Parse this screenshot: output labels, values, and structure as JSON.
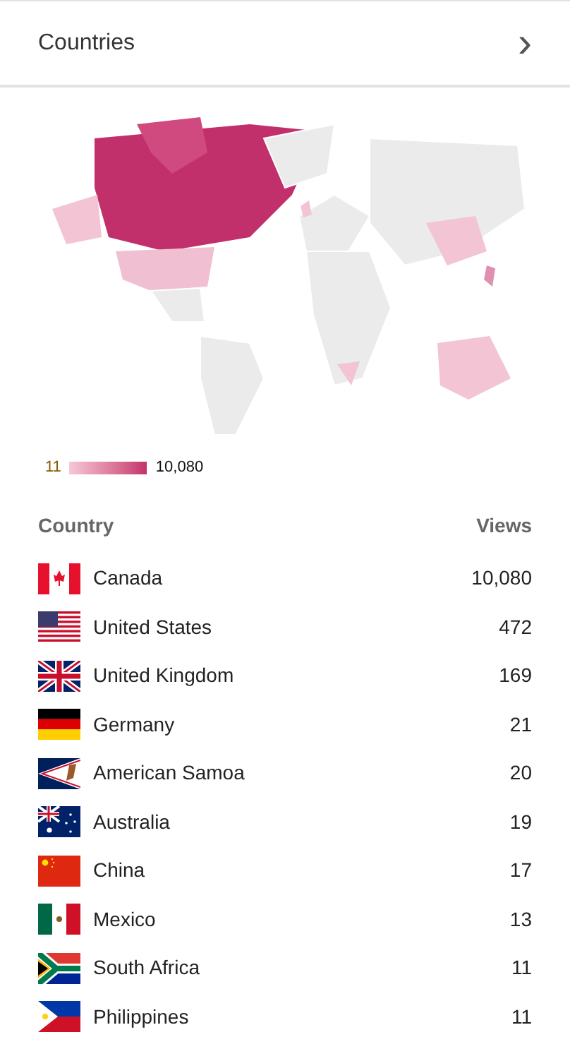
{
  "header": {
    "title": "Countries",
    "chevron": "›"
  },
  "legend": {
    "min": "11",
    "max": "10,080"
  },
  "table": {
    "columns": [
      "Country",
      "Views"
    ],
    "rows": [
      {
        "kind": "ca",
        "country": "Canada",
        "views": "10,080"
      },
      {
        "kind": "us",
        "country": "United States",
        "views": "472"
      },
      {
        "kind": "gb",
        "country": "United Kingdom",
        "views": "169"
      },
      {
        "kind": "de",
        "country": "Germany",
        "views": "21"
      },
      {
        "kind": "as",
        "country": "American Samoa",
        "views": "20"
      },
      {
        "kind": "au",
        "country": "Australia",
        "views": "19"
      },
      {
        "kind": "cn",
        "country": "China",
        "views": "17"
      },
      {
        "kind": "mx",
        "country": "Mexico",
        "views": "13"
      },
      {
        "kind": "za",
        "country": "South Africa",
        "views": "11"
      },
      {
        "kind": "ph",
        "country": "Philippines",
        "views": "11"
      }
    ]
  }
}
